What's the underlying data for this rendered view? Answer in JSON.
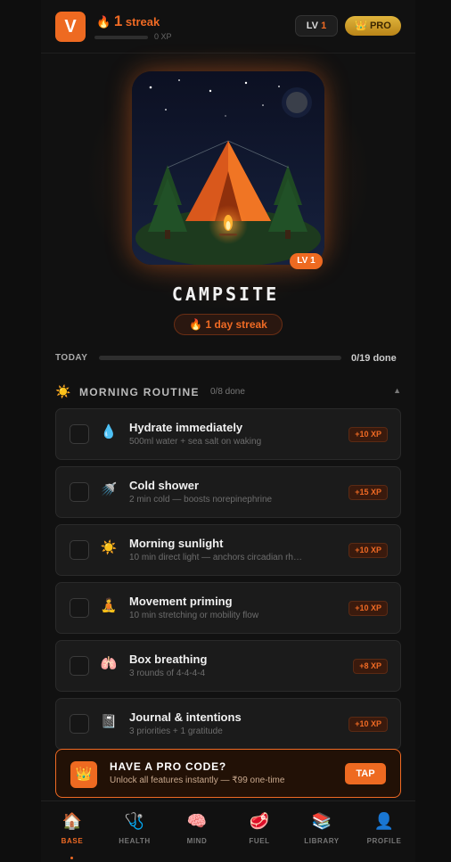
{
  "header": {
    "avatar_letter": "V",
    "streak_icon": "🔥",
    "streak_count": "1",
    "streak_label": "streak",
    "xp_label": "0 XP",
    "xp_progress": 0,
    "level_prefix": "LV",
    "level_value": "1",
    "pro_icon": "👑",
    "pro_label": "PRO"
  },
  "hero": {
    "scene_name": "campsite-illustration",
    "level_badge": "LV 1",
    "title": "CAMPSITE",
    "streak_icon": "🔥",
    "streak_text": "1 day streak"
  },
  "today": {
    "label": "TODAY",
    "done_text": "0/19 done",
    "progress": 0
  },
  "section": {
    "icon": "☀️",
    "title": "MORNING ROUTINE",
    "count": "0/8 done",
    "chevron": "▲"
  },
  "tasks": [
    {
      "icon": "💧",
      "icon_name": "water-drop-icon",
      "name": "Hydrate immediately",
      "sub": "500ml water + sea salt on waking",
      "xp": "+10 XP"
    },
    {
      "icon": "🚿",
      "icon_name": "shower-icon",
      "name": "Cold shower",
      "sub": "2 min cold — boosts norepinephrine",
      "xp": "+15 XP"
    },
    {
      "icon": "☀️",
      "icon_name": "sun-icon",
      "name": "Morning sunlight",
      "sub": "10 min direct light — anchors circadian rh…",
      "xp": "+10 XP"
    },
    {
      "icon": "🧘",
      "icon_name": "meditation-icon",
      "name": "Movement priming",
      "sub": "10 min stretching or mobility flow",
      "xp": "+10 XP"
    },
    {
      "icon": "🫁",
      "icon_name": "lungs-icon",
      "name": "Box breathing",
      "sub": "3 rounds of 4-4-4-4",
      "xp": "+8 XP"
    },
    {
      "icon": "📓",
      "icon_name": "notebook-icon",
      "name": "Journal & intentions",
      "sub": "3 priorities + 1 gratitude",
      "xp": "+10 XP"
    }
  ],
  "promo": {
    "icon": "👑",
    "title": "HAVE A PRO CODE?",
    "sub": "Unlock all features instantly — ₹99 one-time",
    "button": "TAP"
  },
  "nav": [
    {
      "icon": "🏠",
      "icon_name": "home-icon",
      "label": "BASE",
      "active": true
    },
    {
      "icon": "🩺",
      "icon_name": "stethoscope-icon",
      "label": "HEALTH",
      "active": false
    },
    {
      "icon": "🧠",
      "icon_name": "brain-icon",
      "label": "MIND",
      "active": false
    },
    {
      "icon": "🥩",
      "icon_name": "meat-icon",
      "label": "FUEL",
      "active": false
    },
    {
      "icon": "📚",
      "icon_name": "books-icon",
      "label": "LIBRARY",
      "active": false
    },
    {
      "icon": "👤",
      "icon_name": "user-icon",
      "label": "PROFILE",
      "active": false
    }
  ],
  "colors": {
    "accent": "#ee6a21",
    "background": "#111111",
    "card": "#1b1b1b",
    "gold": "#d4a22e"
  }
}
